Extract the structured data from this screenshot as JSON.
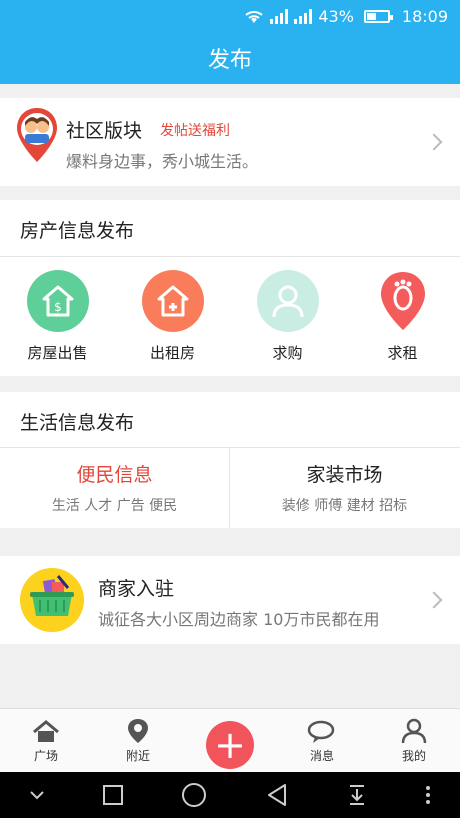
{
  "status_bar": {
    "battery": "43%",
    "time": "18:09",
    "net1": "2G",
    "net2": "4G"
  },
  "header": {
    "title": "发布"
  },
  "community": {
    "title": "社区版块",
    "promo": "发帖送福利",
    "desc": "爆料身边事，秀小城生活。"
  },
  "real_estate": {
    "title": "房产信息发布",
    "items": [
      {
        "label": "房屋出售",
        "color": "#5fcf9a"
      },
      {
        "label": "出租房",
        "color": "#f97d5b"
      },
      {
        "label": "求购",
        "color": "#c9ede3"
      },
      {
        "label": "求租",
        "color": "#f45b5b"
      }
    ]
  },
  "life_info": {
    "title": "生活信息发布",
    "cols": [
      {
        "title": "便民信息",
        "sub": "生活 人才 广告 便民",
        "color": "#e2473a"
      },
      {
        "title": "家装市场",
        "sub": "装修 师傅 建材 招标",
        "color": "#222222"
      }
    ]
  },
  "merchant": {
    "title": "商家入驻",
    "desc": "诚征各大小区周边商家 10万市民都在用"
  },
  "tabbar": {
    "items": [
      {
        "label": "广场"
      },
      {
        "label": "附近"
      },
      {
        "label": ""
      },
      {
        "label": "消息"
      },
      {
        "label": "我的"
      }
    ]
  },
  "colors": {
    "accent": "#29b1f0",
    "red": "#e2473a",
    "publish": "#f2545b"
  }
}
